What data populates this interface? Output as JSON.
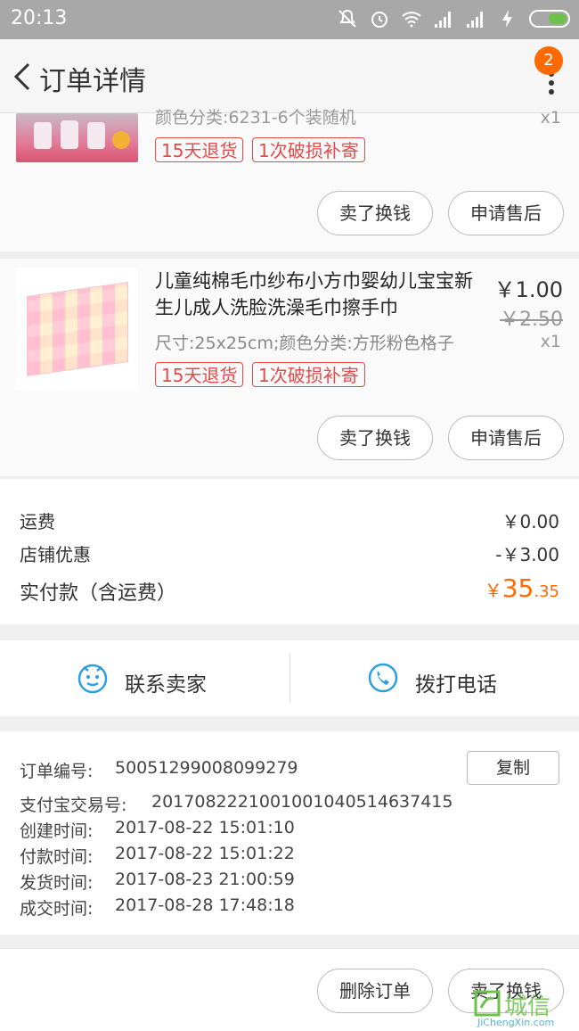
{
  "status": {
    "time": "20:13"
  },
  "header": {
    "title": "订单详情",
    "badge": "2"
  },
  "item1": {
    "spec_partial": "颜色分类:6231-6个装随机",
    "qty": "x1",
    "tags": [
      "15天退货",
      "1次破损补寄"
    ],
    "btn_sell": "卖了换钱",
    "btn_after": "申请售后"
  },
  "item2": {
    "title": "儿童纯棉毛巾纱布小方巾婴幼儿宝宝新生儿成人洗脸洗澡毛巾擦手巾",
    "spec": "尺寸:25x25cm;颜色分类:方形粉色格子",
    "price": "￥1.00",
    "old_price": "￥2.50",
    "qty": "x1",
    "tags": [
      "15天退货",
      "1次破损补寄"
    ],
    "btn_sell": "卖了换钱",
    "btn_after": "申请售后"
  },
  "summary": {
    "shipping_label": "运费",
    "shipping_value": "￥0.00",
    "discount_label": "店铺优惠",
    "discount_value": "-￥3.00",
    "paid_label": "实付款（含运费）",
    "paid_symbol": "￥",
    "paid_main": "35",
    "paid_decimal": ".35"
  },
  "contact": {
    "seller": "联系卖家",
    "call": "拨打电话"
  },
  "info": {
    "order_no_label": "订单编号:",
    "order_no": "50051299008099279",
    "copy": "复制",
    "alipay_label": "支付宝交易号:",
    "alipay_no": "2017082221001001040514637415",
    "created_label": "创建时间:",
    "created": "2017-08-22 15:01:10",
    "paid_label": "付款时间:",
    "paid": "2017-08-22 15:01:22",
    "shipped_label": "发货时间:",
    "shipped": "2017-08-23 21:00:59",
    "deal_label": "成交时间:",
    "deal": "2017-08-28 17:48:18"
  },
  "footer": {
    "delete": "删除订单",
    "sell": "卖了换钱"
  },
  "watermark": {
    "text": "城信",
    "url": "JiChengXin.com"
  },
  "colors": {
    "accent": "#ff6a00",
    "tag": "#e34a4a",
    "icon_blue": "#2d9fe0"
  }
}
